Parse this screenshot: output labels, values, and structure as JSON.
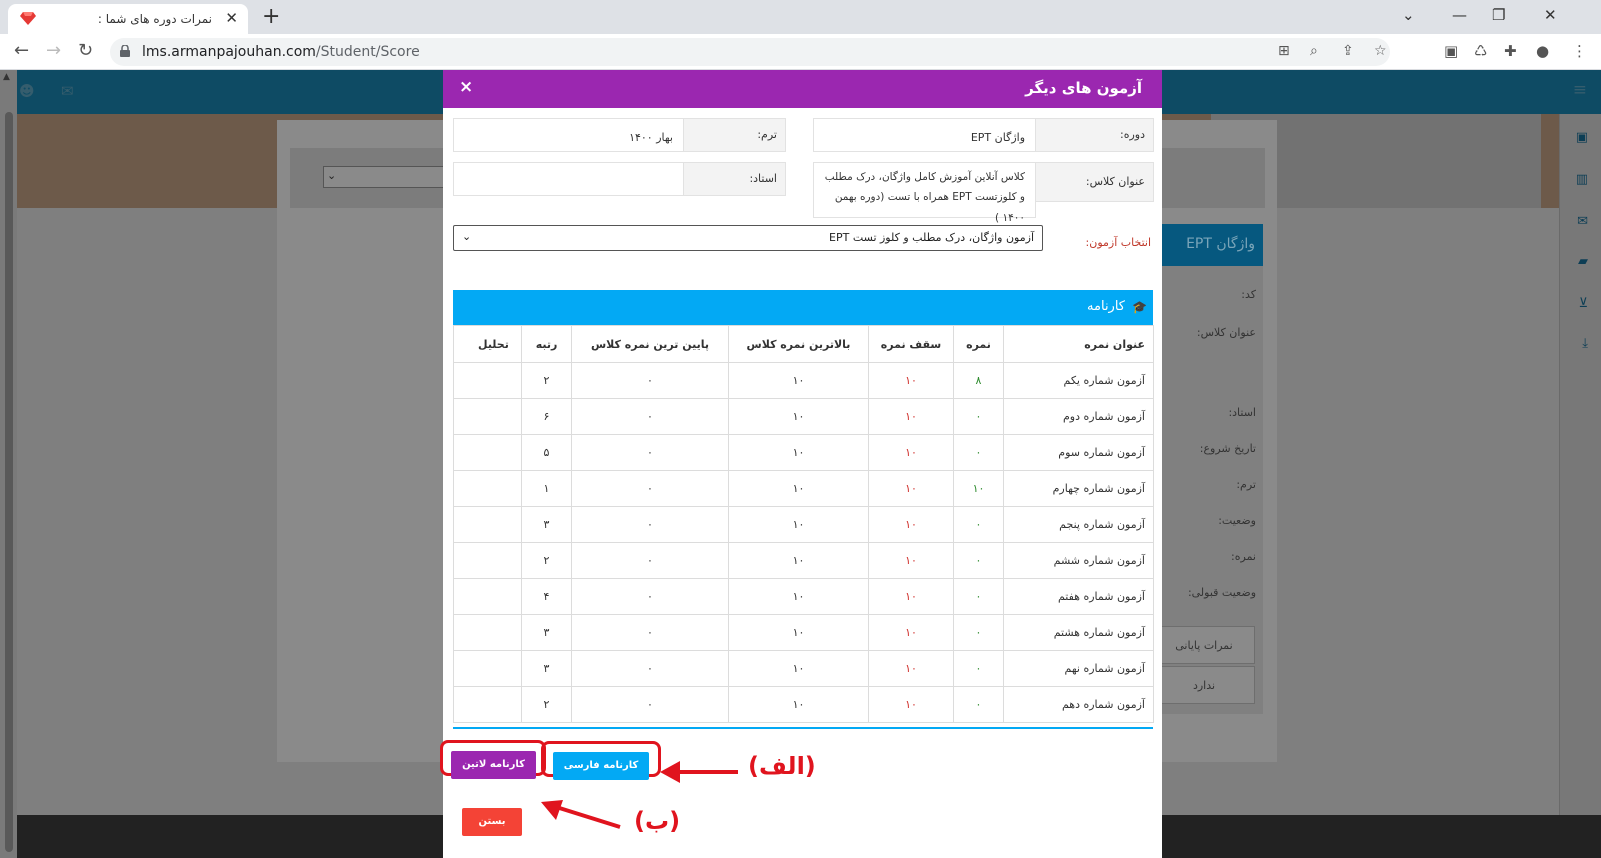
{
  "browser": {
    "tab_title": "نمرات دوره های شما :",
    "url_host": "lms.armanpajouhan.com",
    "url_path": "/Student/Score"
  },
  "lms": {
    "card_title": "واژگان EPT",
    "card_lines": [
      "کد:",
      "عنوان کلاس:",
      "استاد:",
      "تاریخ شروع:",
      "ترم:",
      "وضعیت:",
      "نمره:",
      "وضعیت قبولی:"
    ],
    "final_scores_label": "نمرات پایانی",
    "final_scores_value": "ندارد"
  },
  "modal": {
    "title": "آزمون های دیگر",
    "close_glyph": "×",
    "fields": {
      "course_label": "دوره:",
      "course_value": "واژگان EPT",
      "term_label": "ترم:",
      "term_value": "بهار ۱۴۰۰",
      "class_title_label": "عنوان کلاس:",
      "class_title_value": "کلاس آنلاین آموزش کامل واژگان، درک مطلب و کلوزتست EPT همراه با تست (دوره بهمن ۱۴۰۰ )",
      "teacher_label": "استاد:",
      "teacher_value": ""
    },
    "exam_select": {
      "label": "انتخاب آزمون:",
      "selected": "آزمون واژگان، درک مطلب و کلوز تست EPT"
    },
    "report": {
      "title": "کارنامه",
      "columns": [
        "عنوان نمره",
        "نمره",
        "سقف نمره",
        "بالاترین نمره کلاس",
        "پایین ترین نمره کلاس",
        "رتبه",
        "تحلیل"
      ],
      "rows": [
        {
          "name": "آزمون شماره یکم",
          "score": "۸",
          "max": "۱۰",
          "highest": "۱۰",
          "lowest": "۰",
          "rank": "۲",
          "analysis": ""
        },
        {
          "name": "آزمون شماره دوم",
          "score": "۰",
          "max": "۱۰",
          "highest": "۱۰",
          "lowest": "۰",
          "rank": "۶",
          "analysis": ""
        },
        {
          "name": "آزمون شماره سوم",
          "score": "۰",
          "max": "۱۰",
          "highest": "۱۰",
          "lowest": "۰",
          "rank": "۵",
          "analysis": ""
        },
        {
          "name": "آزمون شماره چهارم",
          "score": "۱۰",
          "max": "۱۰",
          "highest": "۱۰",
          "lowest": "۰",
          "rank": "۱",
          "analysis": ""
        },
        {
          "name": "آزمون شماره پنجم",
          "score": "۰",
          "max": "۱۰",
          "highest": "۱۰",
          "lowest": "۰",
          "rank": "۳",
          "analysis": ""
        },
        {
          "name": "آزمون شماره ششم",
          "score": "۰",
          "max": "۱۰",
          "highest": "۱۰",
          "lowest": "۰",
          "rank": "۲",
          "analysis": ""
        },
        {
          "name": "آزمون شماره هفتم",
          "score": "۰",
          "max": "۱۰",
          "highest": "۱۰",
          "lowest": "۰",
          "rank": "۴",
          "analysis": ""
        },
        {
          "name": "آزمون شماره هشتم",
          "score": "۰",
          "max": "۱۰",
          "highest": "۱۰",
          "lowest": "۰",
          "rank": "۳",
          "analysis": ""
        },
        {
          "name": "آزمون شماره نهم",
          "score": "۰",
          "max": "۱۰",
          "highest": "۱۰",
          "lowest": "۰",
          "rank": "۳",
          "analysis": ""
        },
        {
          "name": "آزمون شماره دهم",
          "score": "۰",
          "max": "۱۰",
          "highest": "۱۰",
          "lowest": "۰",
          "rank": "۲",
          "analysis": ""
        }
      ]
    },
    "buttons": {
      "farsi_report": "کارنامه فارسی",
      "latin_report": "کارنامه لاتین",
      "close": "بستن"
    }
  },
  "annotations": {
    "alef": "(الف)",
    "be": "(ب)",
    "color": "#e0141e"
  }
}
